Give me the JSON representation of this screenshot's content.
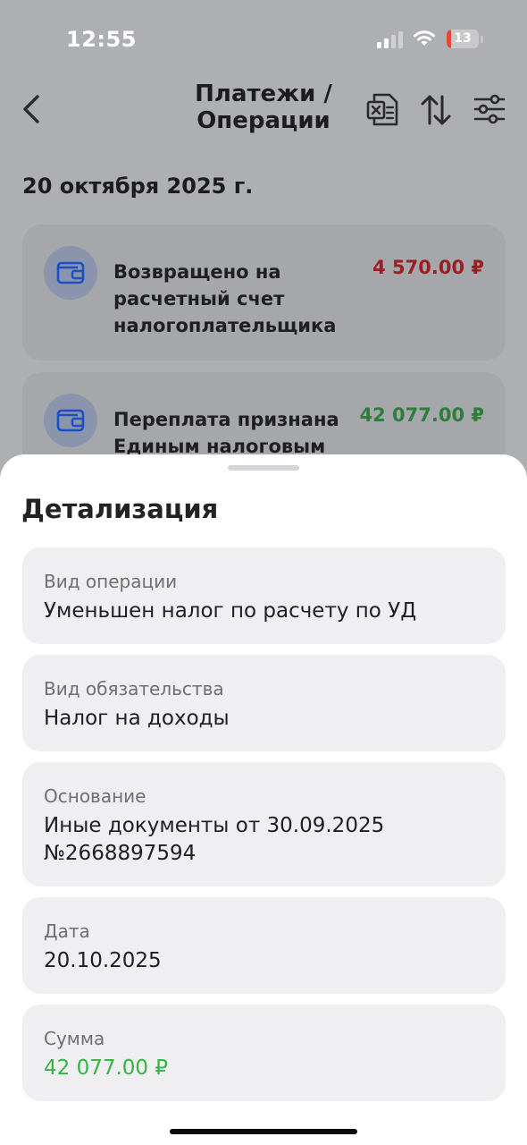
{
  "status_bar": {
    "time": "12:55",
    "battery_level": "13",
    "icons": [
      "cellular-signal-icon",
      "wifi-icon",
      "battery-icon"
    ]
  },
  "nav": {
    "title": "Платежи / Операции",
    "icons": [
      "back-chevron-icon",
      "excel-export-icon",
      "sort-icon",
      "filter-sliders-icon"
    ]
  },
  "date_header": "20 октября 2025 г.",
  "operations": [
    {
      "icon": "wallet-icon",
      "text": "Возвращено на расчетный счет налогоплательщика",
      "amount": "4 570.00 ₽",
      "amount_color": "#9a1f24"
    },
    {
      "icon": "wallet-icon",
      "text": "Переплата признана Единым налоговым",
      "amount": "42 077.00 ₽",
      "amount_color": "#2f7d3b"
    }
  ],
  "sheet": {
    "title": "Детализация",
    "details": [
      {
        "label": "Вид операции",
        "value": "Уменьшен налог по расчету по УД"
      },
      {
        "label": "Вид обязательства",
        "value": "Налог на доходы"
      },
      {
        "label": "Основание",
        "value": "Иные документы от 30.09.2025 №2668897594"
      },
      {
        "label": "Дата",
        "value": "20.10.2025"
      },
      {
        "label": "Сумма",
        "value": "42 077.00 ₽",
        "value_color": "#35b545"
      }
    ]
  },
  "colors": {
    "accent_blue": "#1f4fc0",
    "amount_green": "#35b545",
    "amount_red": "#9a1f24"
  }
}
